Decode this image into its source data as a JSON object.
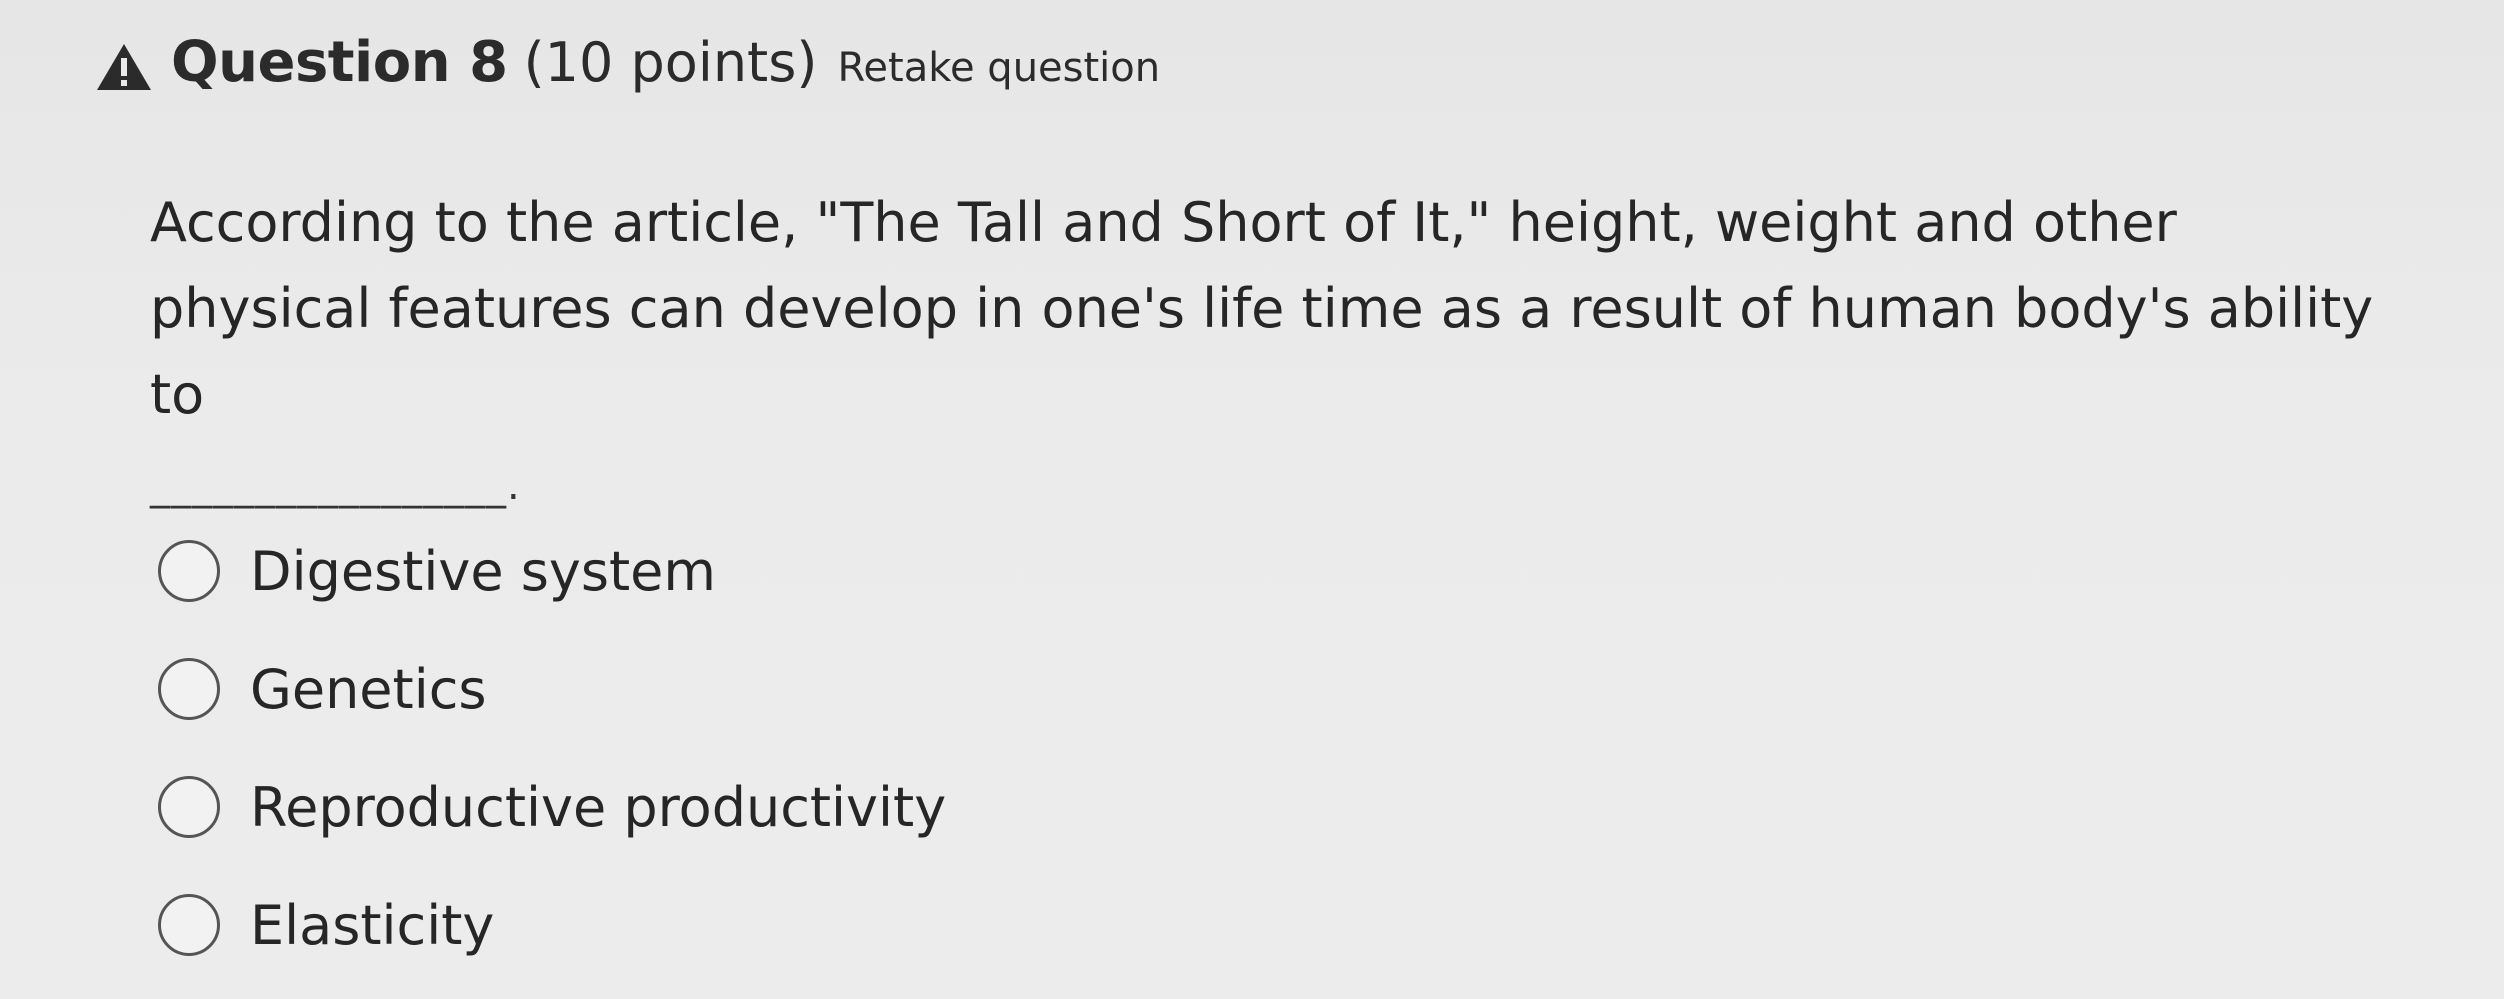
{
  "header": {
    "icon": "warning-icon",
    "title": "Question 8",
    "points": "(10 points)",
    "retake": "Retake question"
  },
  "question": {
    "text": "According to the article, \"The Tall and Short of It,\" height, weight and other physical features can develop in one's life time as a result of human body's ability to",
    "blank": "_________________."
  },
  "options": [
    {
      "label": "Digestive system",
      "selected": false
    },
    {
      "label": "Genetics",
      "selected": false
    },
    {
      "label": "Reproductive productivity",
      "selected": false
    },
    {
      "label": "Elasticity",
      "selected": false
    }
  ],
  "colors": {
    "background": "#e9e9e9",
    "text": "#2b2b2b",
    "radio_border": "#555555"
  }
}
